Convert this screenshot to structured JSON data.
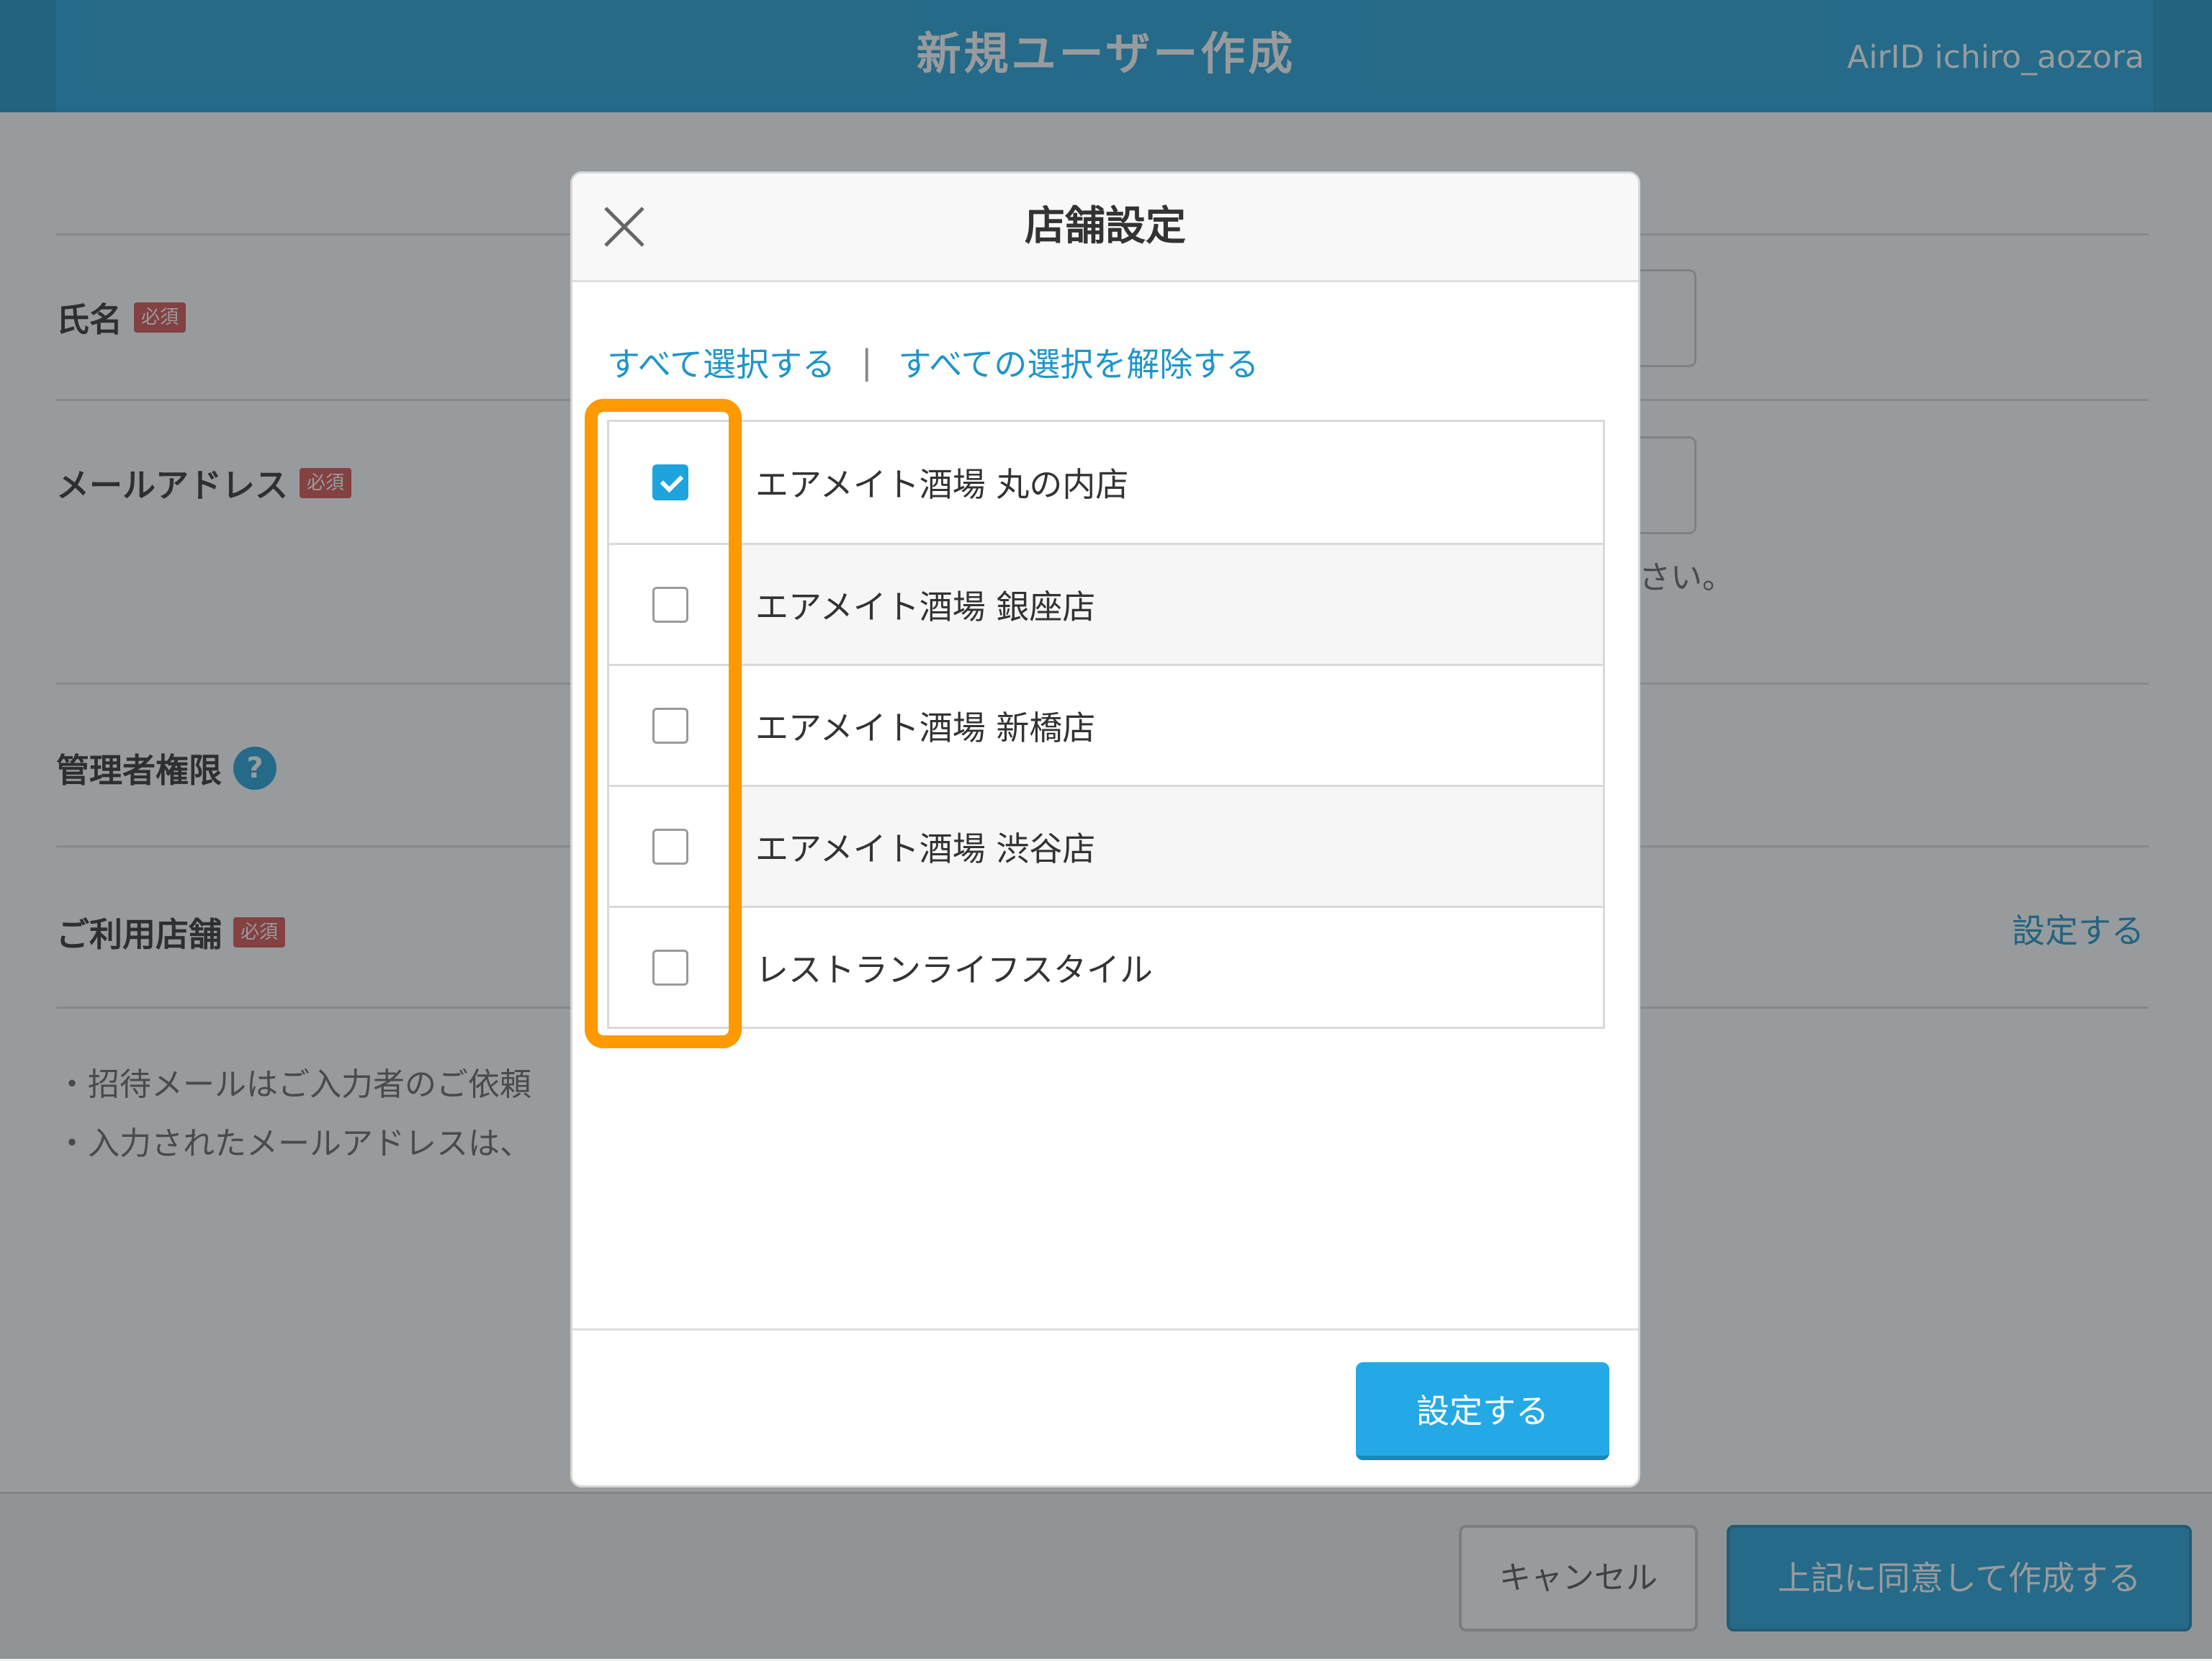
{
  "header": {
    "title": "新規ユーザー作成",
    "airid": "AirID ichiro_aozora"
  },
  "form": {
    "name_label": "氏名",
    "email_label": "メールアドレス",
    "email_note_fragment": "さい。",
    "admin_label": "管理者権限",
    "help_icon_glyph": "?",
    "store_label": "ご利用店舗",
    "store_setting_link": "設定する",
    "required_badge": "必須",
    "notes": [
      "・招待メールはご入力者のご依頼",
      "・入力されたメールアドレスは、"
    ]
  },
  "footer": {
    "cancel_label": "キャンセル",
    "submit_label": "上記に同意して作成する"
  },
  "modal": {
    "title": "店舗設定",
    "select_all": "すべて選択する",
    "separator": "|",
    "deselect_all": "すべての選択を解除する",
    "stores": [
      {
        "name": "エアメイト酒場 丸の内店",
        "checked": true
      },
      {
        "name": "エアメイト酒場 銀座店",
        "checked": false
      },
      {
        "name": "エアメイト酒場 新橋店",
        "checked": false
      },
      {
        "name": "エアメイト酒場 渋谷店",
        "checked": false
      },
      {
        "name": "レストランライフスタイル",
        "checked": false
      }
    ],
    "confirm_label": "設定する"
  },
  "colors": {
    "accent": "#24a1d6",
    "highlight": "#ff9900",
    "required": "#d9534f"
  }
}
